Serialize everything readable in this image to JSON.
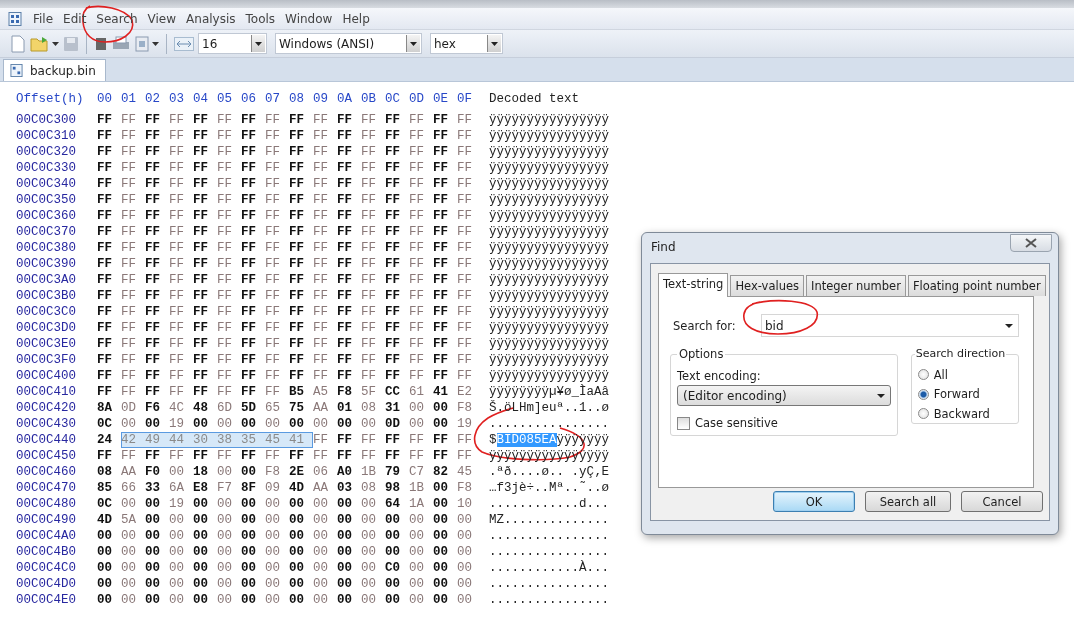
{
  "menu": [
    {
      "label": "File"
    },
    {
      "label": "Edit"
    },
    {
      "label": "Search"
    },
    {
      "label": "View"
    },
    {
      "label": "Analysis"
    },
    {
      "label": "Tools"
    },
    {
      "label": "Window"
    },
    {
      "label": "Help"
    }
  ],
  "toolbar": {
    "bytes_per_row": "16",
    "encoding": "Windows (ANSI)",
    "format": "hex"
  },
  "document_tabs": [
    {
      "label": "backup.bin",
      "selected": true
    }
  ],
  "hex_view": {
    "offset_heading": "Offset(h)",
    "column_headings": [
      "00",
      "01",
      "02",
      "03",
      "04",
      "05",
      "06",
      "07",
      "08",
      "09",
      "0A",
      "0B",
      "0C",
      "0D",
      "0E",
      "0F"
    ],
    "decoded_heading": "Decoded text",
    "rows": [
      {
        "offset": "00C0C300",
        "bytes": [
          {
            "text": "FF FF FF FF FF FF FF FF FF FF FF FF FF FF FF FF",
            "selected": false
          }
        ],
        "decoded": [
          {
            "text": "ÿÿÿÿÿÿÿÿÿÿÿÿÿÿÿÿ",
            "selected": false
          }
        ]
      },
      {
        "offset": "00C0C310",
        "bytes": [
          {
            "text": "FF FF FF FF FF FF FF FF FF FF FF FF FF FF FF FF",
            "selected": false
          }
        ],
        "decoded": [
          {
            "text": "ÿÿÿÿÿÿÿÿÿÿÿÿÿÿÿÿ",
            "selected": false
          }
        ]
      },
      {
        "offset": "00C0C320",
        "bytes": [
          {
            "text": "FF FF FF FF FF FF FF FF FF FF FF FF FF FF FF FF",
            "selected": false
          }
        ],
        "decoded": [
          {
            "text": "ÿÿÿÿÿÿÿÿÿÿÿÿÿÿÿÿ",
            "selected": false
          }
        ]
      },
      {
        "offset": "00C0C330",
        "bytes": [
          {
            "text": "FF FF FF FF FF FF FF FF FF FF FF FF FF FF FF FF",
            "selected": false
          }
        ],
        "decoded": [
          {
            "text": "ÿÿÿÿÿÿÿÿÿÿÿÿÿÿÿÿ",
            "selected": false
          }
        ]
      },
      {
        "offset": "00C0C340",
        "bytes": [
          {
            "text": "FF FF FF FF FF FF FF FF FF FF FF FF FF FF FF FF",
            "selected": false
          }
        ],
        "decoded": [
          {
            "text": "ÿÿÿÿÿÿÿÿÿÿÿÿÿÿÿÿ",
            "selected": false
          }
        ]
      },
      {
        "offset": "00C0C350",
        "bytes": [
          {
            "text": "FF FF FF FF FF FF FF FF FF FF FF FF FF FF FF FF",
            "selected": false
          }
        ],
        "decoded": [
          {
            "text": "ÿÿÿÿÿÿÿÿÿÿÿÿÿÿÿÿ",
            "selected": false
          }
        ]
      },
      {
        "offset": "00C0C360",
        "bytes": [
          {
            "text": "FF FF FF FF FF FF FF FF FF FF FF FF FF FF FF FF",
            "selected": false
          }
        ],
        "decoded": [
          {
            "text": "ÿÿÿÿÿÿÿÿÿÿÿÿÿÿÿÿ",
            "selected": false
          }
        ]
      },
      {
        "offset": "00C0C370",
        "bytes": [
          {
            "text": "FF FF FF FF FF FF FF FF FF FF FF FF FF FF FF FF",
            "selected": false
          }
        ],
        "decoded": [
          {
            "text": "ÿÿÿÿÿÿÿÿÿÿÿÿÿÿÿÿ",
            "selected": false
          }
        ]
      },
      {
        "offset": "00C0C380",
        "bytes": [
          {
            "text": "FF FF FF FF FF FF FF FF FF FF FF FF FF FF FF FF",
            "selected": false
          }
        ],
        "decoded": [
          {
            "text": "ÿÿÿÿÿÿÿÿÿÿÿÿÿÿÿÿ",
            "selected": false
          }
        ]
      },
      {
        "offset": "00C0C390",
        "bytes": [
          {
            "text": "FF FF FF FF FF FF FF FF FF FF FF FF FF FF FF FF",
            "selected": false
          }
        ],
        "decoded": [
          {
            "text": "ÿÿÿÿÿÿÿÿÿÿÿÿÿÿÿÿ",
            "selected": false
          }
        ]
      },
      {
        "offset": "00C0C3A0",
        "bytes": [
          {
            "text": "FF FF FF FF FF FF FF FF FF FF FF FF FF FF FF FF",
            "selected": false
          }
        ],
        "decoded": [
          {
            "text": "ÿÿÿÿÿÿÿÿÿÿÿÿÿÿÿÿ",
            "selected": false
          }
        ]
      },
      {
        "offset": "00C0C3B0",
        "bytes": [
          {
            "text": "FF FF FF FF FF FF FF FF FF FF FF FF FF FF FF FF",
            "selected": false
          }
        ],
        "decoded": [
          {
            "text": "ÿÿÿÿÿÿÿÿÿÿÿÿÿÿÿÿ",
            "selected": false
          }
        ]
      },
      {
        "offset": "00C0C3C0",
        "bytes": [
          {
            "text": "FF FF FF FF FF FF FF FF FF FF FF FF FF FF FF FF",
            "selected": false
          }
        ],
        "decoded": [
          {
            "text": "ÿÿÿÿÿÿÿÿÿÿÿÿÿÿÿÿ",
            "selected": false
          }
        ]
      },
      {
        "offset": "00C0C3D0",
        "bytes": [
          {
            "text": "FF FF FF FF FF FF FF FF FF FF FF FF FF FF FF FF",
            "selected": false
          }
        ],
        "decoded": [
          {
            "text": "ÿÿÿÿÿÿÿÿÿÿÿÿÿÿÿÿ",
            "selected": false
          }
        ]
      },
      {
        "offset": "00C0C3E0",
        "bytes": [
          {
            "text": "FF FF FF FF FF FF FF FF FF FF FF FF FF FF FF FF",
            "selected": false
          }
        ],
        "decoded": [
          {
            "text": "ÿÿÿÿÿÿÿÿÿÿÿÿÿÿÿÿ",
            "selected": false
          }
        ]
      },
      {
        "offset": "00C0C3F0",
        "bytes": [
          {
            "text": "FF FF FF FF FF FF FF FF FF FF FF FF FF FF FF FF",
            "selected": false
          }
        ],
        "decoded": [
          {
            "text": "ÿÿÿÿÿÿÿÿÿÿÿÿÿÿÿÿ",
            "selected": false
          }
        ]
      },
      {
        "offset": "00C0C400",
        "bytes": [
          {
            "text": "FF FF FF FF FF FF FF FF FF FF FF FF FF FF FF FF",
            "selected": false
          }
        ],
        "decoded": [
          {
            "text": "ÿÿÿÿÿÿÿÿÿÿÿÿÿÿÿÿ",
            "selected": false
          }
        ]
      },
      {
        "offset": "00C0C410",
        "bytes": [
          {
            "text": "FF FF FF FF FF FF FF FF B5 A5 F8 5F CC 61 41 E2",
            "selected": false
          }
        ],
        "decoded": [
          {
            "text": "ÿÿÿÿÿÿÿÿµ¥ø_ÌaAâ",
            "selected": false
          }
        ]
      },
      {
        "offset": "00C0C420",
        "bytes": [
          {
            "text": "8A 0D F6 4C 48 6D 5D 65 75 AA 01 08 31 00 00 F8",
            "selected": false
          }
        ],
        "decoded": [
          {
            "text": "Š.öLHm]euª..1..ø",
            "selected": false
          }
        ]
      },
      {
        "offset": "00C0C430",
        "bytes": [
          {
            "text": "0C 00 00 19 00 00 00 00 00 00 00 00 0D 00 00 19",
            "selected": false
          }
        ],
        "decoded": [
          {
            "text": "................",
            "selected": false
          }
        ]
      },
      {
        "offset": "00C0C440",
        "bytes": [
          {
            "text": "24",
            "selected": false
          },
          {
            "text": "42 49 44 30 38 35 45 41",
            "selected": true
          },
          {
            "text": "FF FF FF FF FF FF FF",
            "selected": false
          }
        ],
        "decoded": [
          {
            "text": "$",
            "selected": false
          },
          {
            "text": "BID085EA",
            "selected": true
          },
          {
            "text": "ÿÿÿÿÿÿÿ",
            "selected": false
          }
        ]
      },
      {
        "offset": "00C0C450",
        "bytes": [
          {
            "text": "FF FF FF FF FF FF FF FF FF FF FF FF FF FF FF FF",
            "selected": false
          }
        ],
        "decoded": [
          {
            "text": "ÿÿÿÿÿÿÿÿÿÿÿÿÿÿÿÿ",
            "selected": false
          }
        ]
      },
      {
        "offset": "00C0C460",
        "bytes": [
          {
            "text": "08 AA F0 00 18 00 00 F8 2E 06 A0 1B 79 C7 82 45",
            "selected": false
          }
        ],
        "decoded": [
          {
            "text": ".ªð....ø.. .yÇ‚E",
            "selected": false
          }
        ]
      },
      {
        "offset": "00C0C470",
        "bytes": [
          {
            "text": "85 66 33 6A E8 F7 8F 09 4D AA 03 08 98 1B 00 F8",
            "selected": false
          }
        ],
        "decoded": [
          {
            "text": "…f3jè÷..Mª..˜..ø",
            "selected": false
          }
        ]
      },
      {
        "offset": "00C0C480",
        "bytes": [
          {
            "text": "0C 00 00 19 00 00 00 00 00 00 00 00 64 1A 00 10",
            "selected": false
          }
        ],
        "decoded": [
          {
            "text": "............d...",
            "selected": false
          }
        ]
      },
      {
        "offset": "00C0C490",
        "bytes": [
          {
            "text": "4D 5A 00 00 00 00 00 00 00 00 00 00 00 00 00 00",
            "selected": false
          }
        ],
        "decoded": [
          {
            "text": "MZ..............",
            "selected": false
          }
        ]
      },
      {
        "offset": "00C0C4A0",
        "bytes": [
          {
            "text": "00 00 00 00 00 00 00 00 00 00 00 00 00 00 00 00",
            "selected": false
          }
        ],
        "decoded": [
          {
            "text": "................",
            "selected": false
          }
        ]
      },
      {
        "offset": "00C0C4B0",
        "bytes": [
          {
            "text": "00 00 00 00 00 00 00 00 00 00 00 00 00 00 00 00",
            "selected": false
          }
        ],
        "decoded": [
          {
            "text": "................",
            "selected": false
          }
        ]
      },
      {
        "offset": "00C0C4C0",
        "bytes": [
          {
            "text": "00 00 00 00 00 00 00 00 00 00 00 00 C0 00 00 00",
            "selected": false
          }
        ],
        "decoded": [
          {
            "text": "............À...",
            "selected": false
          }
        ]
      },
      {
        "offset": "00C0C4D0",
        "bytes": [
          {
            "text": "00 00 00 00 00 00 00 00 00 00 00 00 00 00 00 00",
            "selected": false
          }
        ],
        "decoded": [
          {
            "text": "................",
            "selected": false
          }
        ]
      },
      {
        "offset": "00C0C4E0",
        "bytes": [
          {
            "text": "00 00 00 00 00 00 00 00 00 00 00 00 00 00 00 00",
            "selected": false
          }
        ],
        "decoded": [
          {
            "text": "................",
            "selected": false
          }
        ]
      }
    ]
  },
  "find_dialog": {
    "title": "Find",
    "tabs": [
      {
        "label": "Text-string",
        "selected": true
      },
      {
        "label": "Hex-values",
        "selected": false
      },
      {
        "label": "Integer number",
        "selected": false
      },
      {
        "label": "Floating point number",
        "selected": false
      }
    ],
    "search_for": {
      "label": "Search for:",
      "value": "bid"
    },
    "options": {
      "title": "Options",
      "encoding_label": "Text encoding:",
      "encoding_value": "(Editor encoding)",
      "case_sensitive": {
        "label": "Case sensitive",
        "checked": false
      }
    },
    "direction": {
      "title": "Search direction",
      "options": [
        {
          "label": "All",
          "selected": false
        },
        {
          "label": "Forward",
          "selected": true
        },
        {
          "label": "Backward",
          "selected": false
        }
      ]
    },
    "buttons": [
      {
        "label": "OK",
        "default": true
      },
      {
        "label": "Search all",
        "default": false
      },
      {
        "label": "Cancel",
        "default": false
      }
    ]
  }
}
